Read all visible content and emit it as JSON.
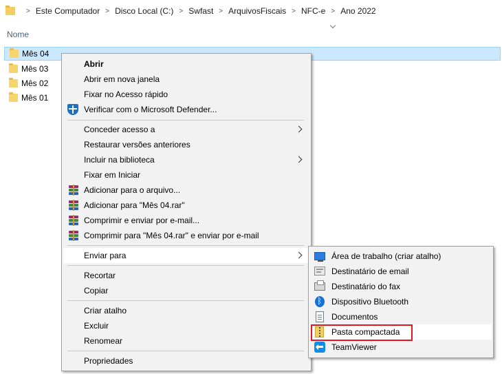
{
  "breadcrumb": [
    "Este Computador",
    "Disco Local (C:)",
    "Swfast",
    "ArquivosFiscais",
    "NFC-e",
    "Ano 2022"
  ],
  "column_header": "Nome",
  "files": [
    {
      "name": "Mês 04",
      "selected": true
    },
    {
      "name": "Mês 03",
      "selected": false
    },
    {
      "name": "Mês 02",
      "selected": false
    },
    {
      "name": "Mês 01",
      "selected": false
    }
  ],
  "context_menu": {
    "items": [
      {
        "label": "Abrir",
        "bold": true
      },
      {
        "label": "Abrir em nova janela"
      },
      {
        "label": "Fixar no Acesso rápido"
      },
      {
        "label": "Verificar com o Microsoft Defender...",
        "icon": "defender-icon"
      },
      {
        "label": "Conceder acesso a",
        "submenu": true
      },
      {
        "label": "Restaurar versões anteriores"
      },
      {
        "label": "Incluir na biblioteca",
        "submenu": true
      },
      {
        "label": "Fixar em Iniciar"
      },
      {
        "label": "Adicionar para o arquivo...",
        "icon": "winrar-icon"
      },
      {
        "label": "Adicionar para \"Mês 04.rar\"",
        "icon": "winrar-icon"
      },
      {
        "label": "Comprimir e enviar por e-mail...",
        "icon": "winrar-icon"
      },
      {
        "label": "Comprimir para \"Mês 04.rar\" e enviar por e-mail",
        "icon": "winrar-icon"
      },
      {
        "label": "Enviar para",
        "submenu": true,
        "hover": true
      },
      {
        "label": "Recortar"
      },
      {
        "label": "Copiar"
      },
      {
        "label": "Criar atalho"
      },
      {
        "label": "Excluir"
      },
      {
        "label": "Renomear"
      },
      {
        "label": "Propriedades"
      }
    ]
  },
  "send_to_menu": {
    "items": [
      {
        "label": "Área de trabalho (criar atalho)",
        "icon": "desktop-icon"
      },
      {
        "label": "Destinatário de email",
        "icon": "mail-icon"
      },
      {
        "label": "Destinatário do fax",
        "icon": "fax-icon"
      },
      {
        "label": "Dispositivo Bluetooth",
        "icon": "bluetooth-icon"
      },
      {
        "label": "Documentos",
        "icon": "documents-icon"
      },
      {
        "label": "Pasta compactada",
        "icon": "zip-folder-icon",
        "hover": true,
        "highlighted": true
      },
      {
        "label": "TeamViewer",
        "icon": "teamviewer-icon"
      }
    ]
  },
  "colors": {
    "selection_bg": "#cce8ff",
    "selection_border": "#99d1ff",
    "menu_bg": "#f2f2f2",
    "highlight_red": "#e4171e"
  }
}
